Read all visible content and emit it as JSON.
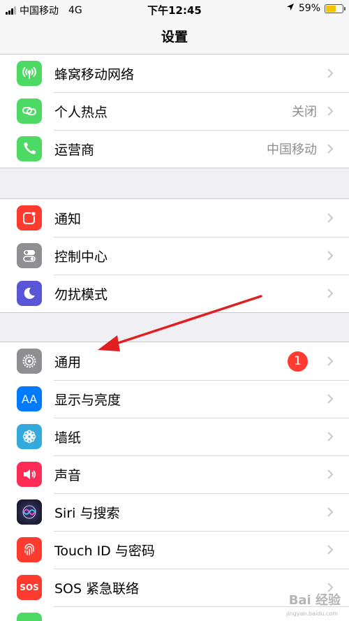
{
  "status_bar": {
    "carrier": "中国移动",
    "network": "4G",
    "time": "下午12:45",
    "battery": "59%",
    "battery_level": 0.59
  },
  "nav": {
    "title": "设置"
  },
  "group1": [
    {
      "label": "蜂窝移动网络",
      "value": "",
      "icon": "antenna-icon",
      "color": "#4cd964"
    },
    {
      "label": "个人热点",
      "value": "关闭",
      "icon": "hotspot-icon",
      "color": "#4cd964"
    },
    {
      "label": "运营商",
      "value": "中国移动",
      "icon": "phone-icon",
      "color": "#4cd964"
    }
  ],
  "group2": [
    {
      "label": "通知",
      "icon": "notifications-icon",
      "color": "#ff3b30"
    },
    {
      "label": "控制中心",
      "icon": "toggles-icon",
      "color": "#8e8e93"
    },
    {
      "label": "勿扰模式",
      "icon": "moon-icon",
      "color": "#5856d6"
    }
  ],
  "group3": [
    {
      "label": "通用",
      "badge": "1",
      "icon": "gear-icon",
      "color": "#8e8e93"
    },
    {
      "label": "显示与亮度",
      "icon": "text-size-icon",
      "color": "#007aff",
      "icon_text": "AA"
    },
    {
      "label": "墙纸",
      "icon": "flower-icon",
      "color": "#34aadc"
    },
    {
      "label": "声音",
      "icon": "speaker-icon",
      "color": "#ff2d55"
    },
    {
      "label": "Siri 与搜索",
      "icon": "siri-icon",
      "color": "#1c1c3c"
    },
    {
      "label": "Touch ID 与密码",
      "icon": "fingerprint-icon",
      "color": "#ff3b30"
    },
    {
      "label": "SOS 紧急联络",
      "icon": "sos-icon",
      "color": "#ff3b30",
      "icon_text": "SOS"
    }
  ],
  "watermark": {
    "text": "Bai 经验",
    "sub": "jingyan.baidu.com"
  }
}
